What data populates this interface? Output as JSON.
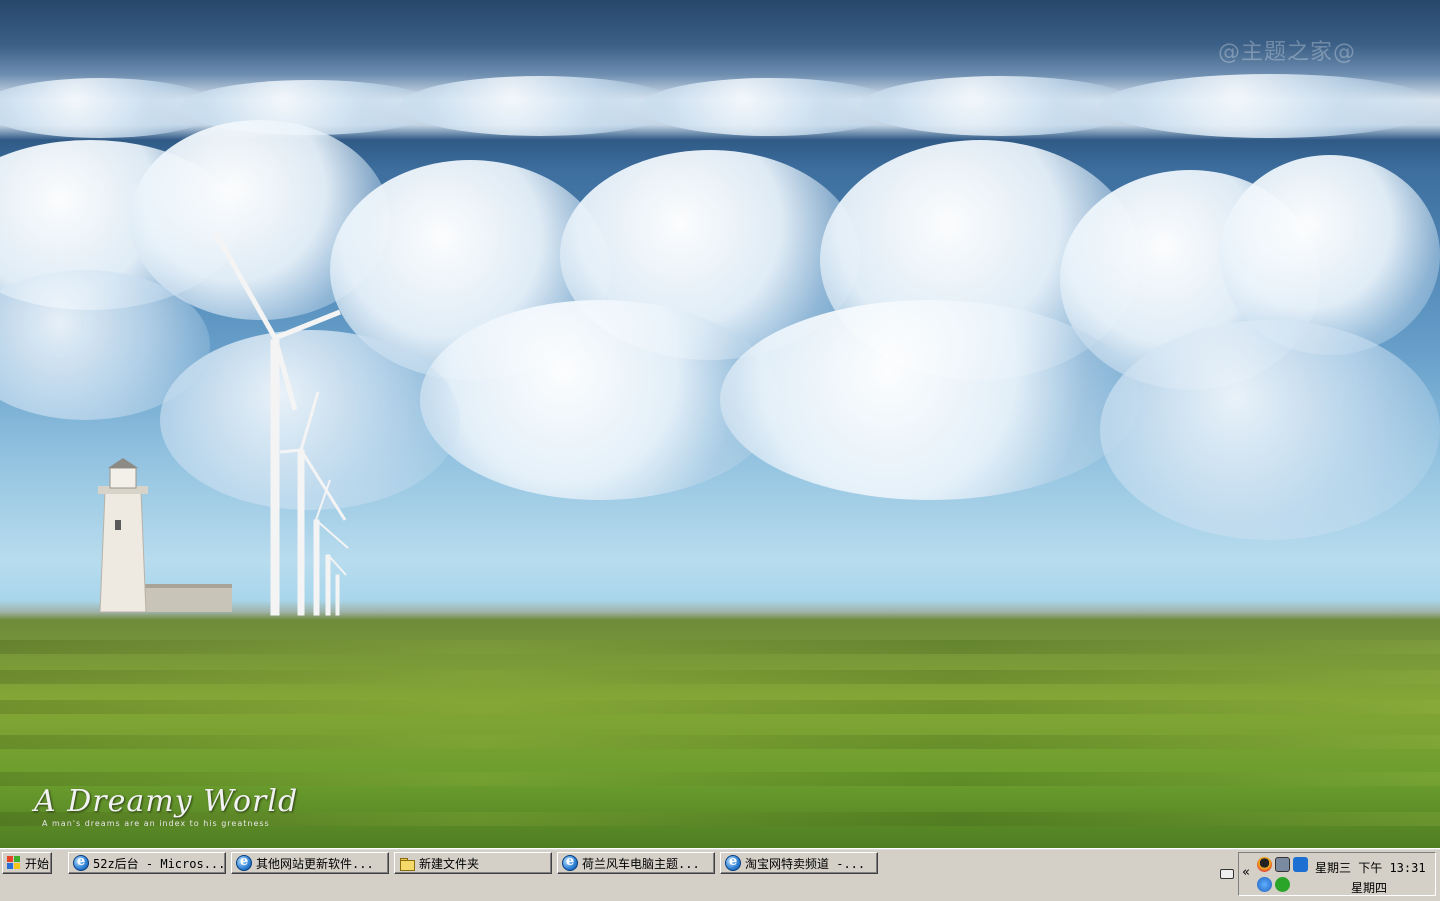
{
  "wallpaper": {
    "title": "A Dreamy World",
    "subtitle": "A man's dreams are an index to his greatness",
    "watermark": "@主题之家@"
  },
  "taskbar": {
    "start_label": "开始",
    "tasks": [
      {
        "label": "52z后台 - Micros...",
        "icon": "ie-icon"
      },
      {
        "label": "其他网站更新软件...",
        "icon": "ie-icon"
      },
      {
        "label": "新建文件夹",
        "icon": "folder-icon"
      },
      {
        "label": "荷兰风车电脑主题...",
        "icon": "ie-icon"
      },
      {
        "label": "淘宝网特卖频道 -...",
        "icon": "ie-icon"
      }
    ],
    "tray": {
      "expand_label": "«",
      "clock_time": "星期三 下午 13:31",
      "clock_day": "星期四"
    }
  },
  "colors": {
    "taskbar_bg": "#d4d0c8",
    "sky_top": "#27476a",
    "grass": "#6b9d2d"
  }
}
